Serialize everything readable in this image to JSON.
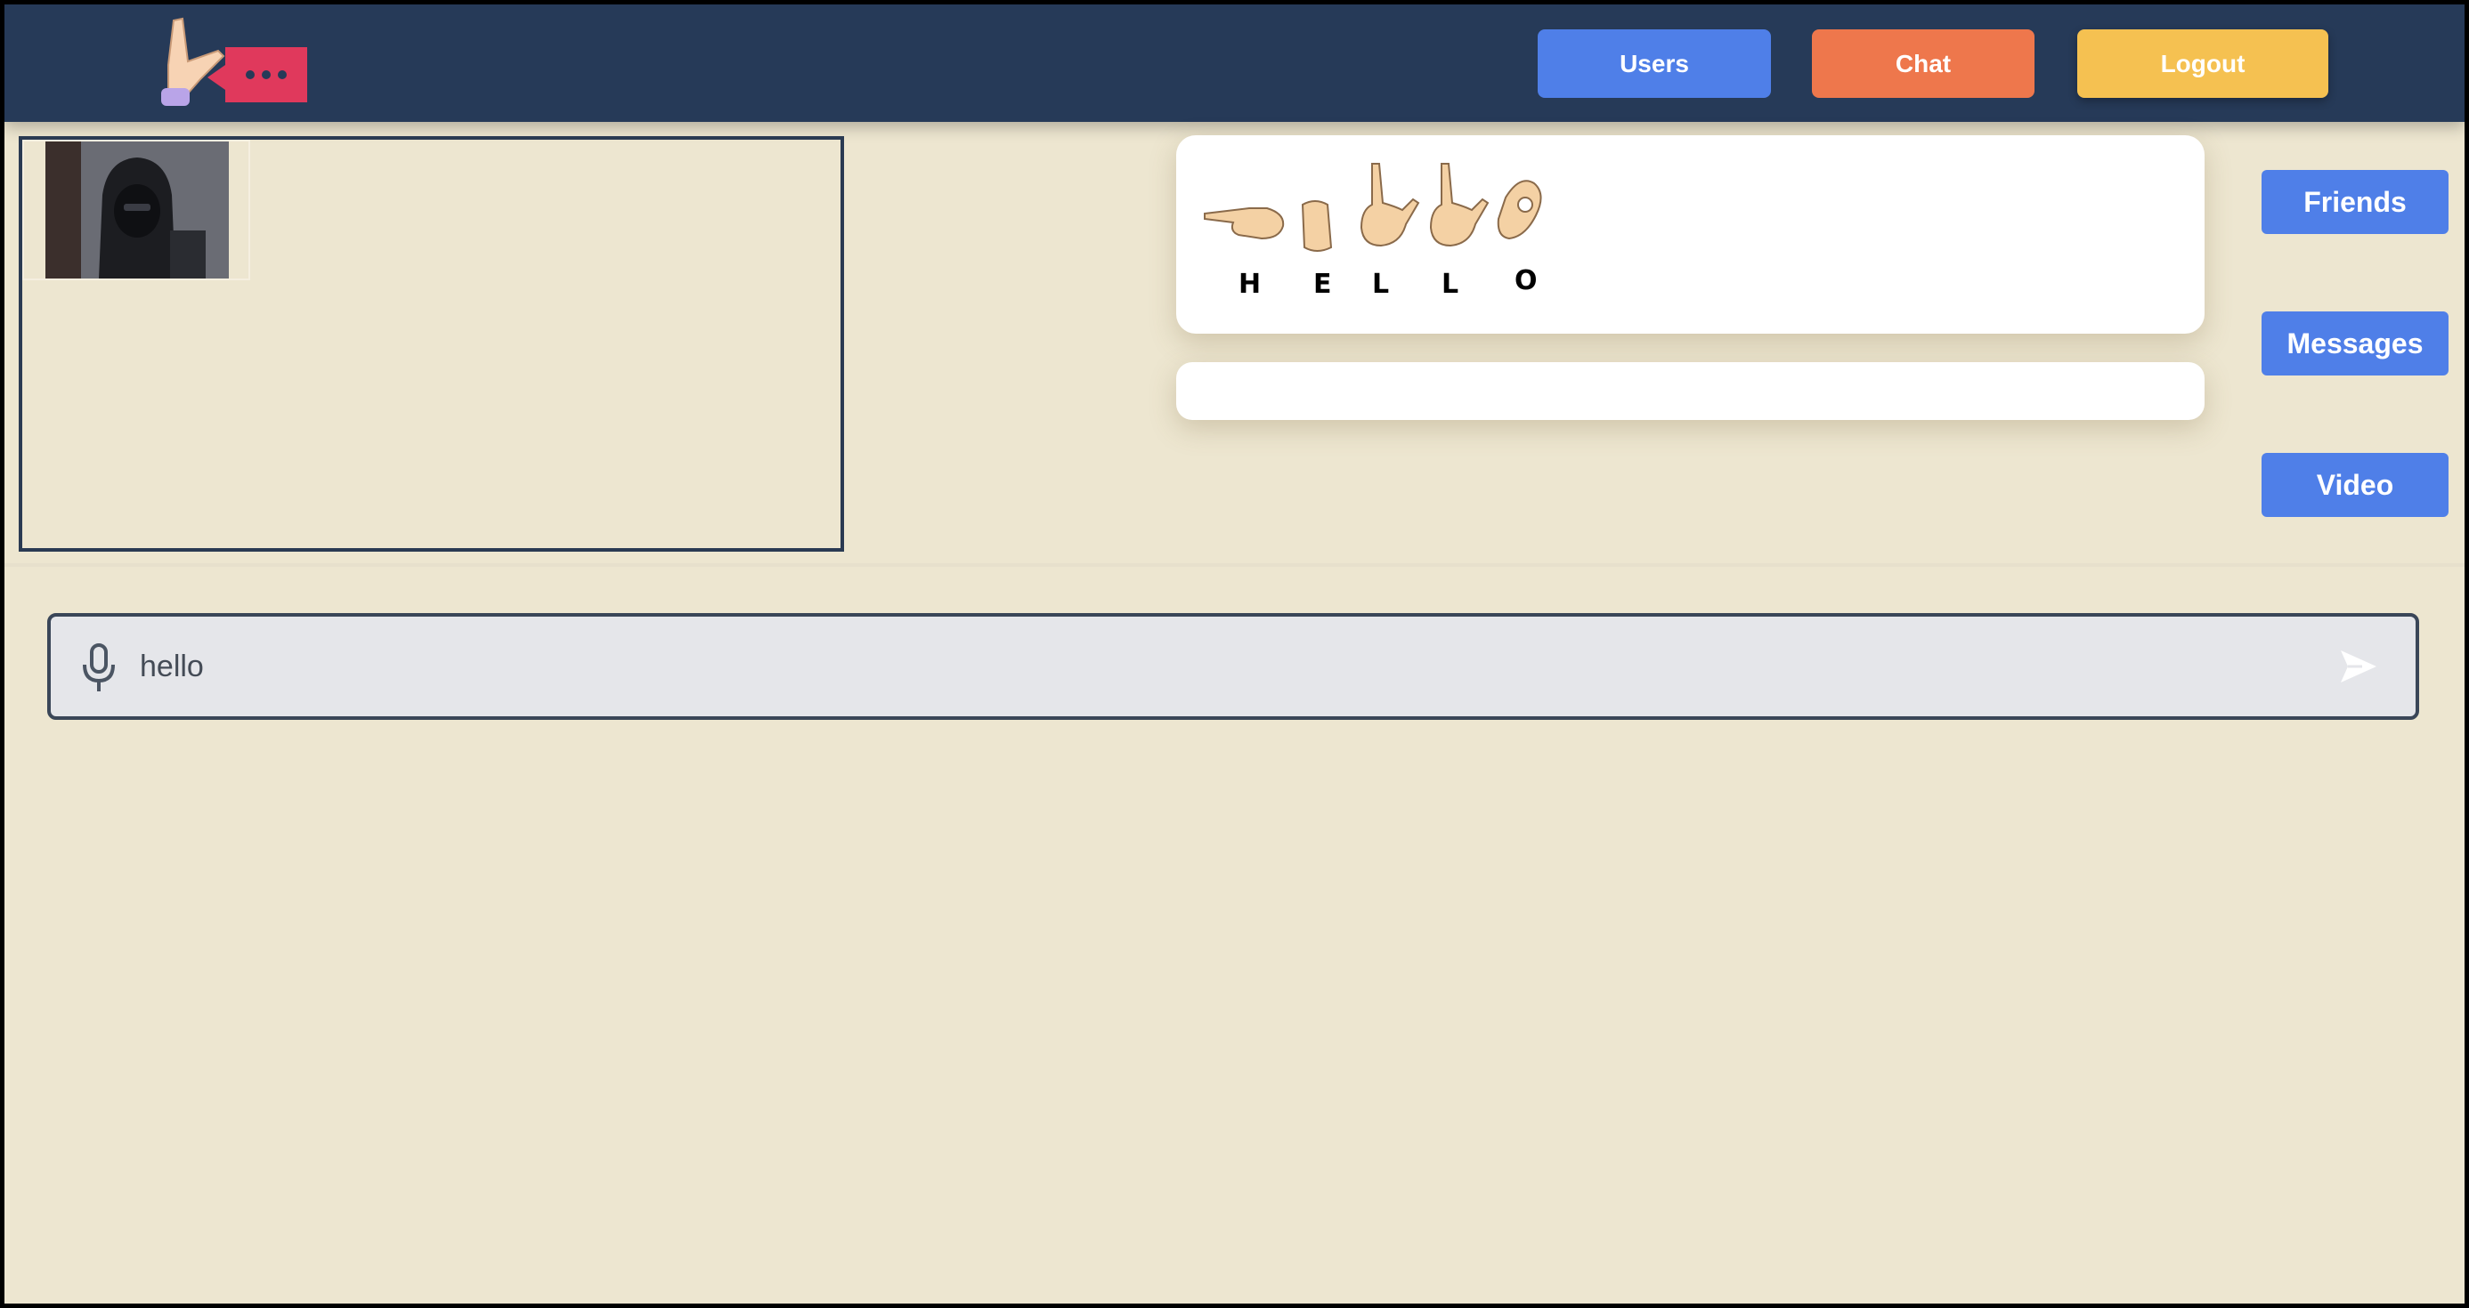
{
  "header": {
    "logo_icon": "hand-chat-logo",
    "nav": {
      "users": "Users",
      "chat": "Chat",
      "logout": "Logout"
    }
  },
  "sign_display": {
    "letters": [
      "H",
      "E",
      "L",
      "L",
      "O"
    ]
  },
  "sidebar": {
    "friends": "Friends",
    "messages": "Messages",
    "video": "Video"
  },
  "composer": {
    "value": "hello",
    "mic_icon": "microphone-icon",
    "send_icon": "send-icon"
  },
  "colors": {
    "header_bg": "#263a58",
    "page_bg": "#ede6d0",
    "users_btn": "#4f7fe8",
    "chat_btn": "#ee774c",
    "logout_btn": "#f5c151"
  }
}
